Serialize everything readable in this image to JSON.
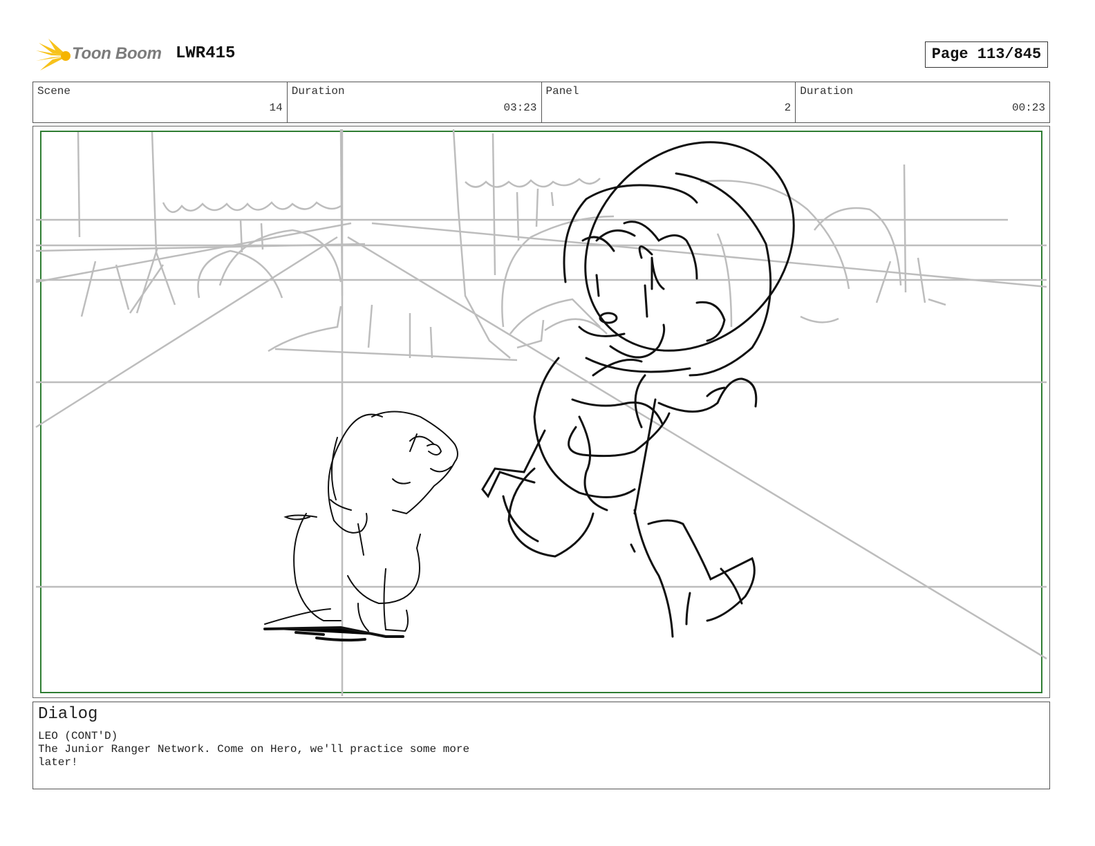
{
  "header": {
    "logo_text": "Toon Boom",
    "logo_color": "#f7c21b",
    "project_code": "LWR415",
    "page_label": "Page 113/845"
  },
  "info": {
    "scene_label": "Scene",
    "scene_value": "14",
    "scene_duration_label": "Duration",
    "scene_duration_value": "03:23",
    "panel_label": "Panel",
    "panel_value": "2",
    "panel_duration_label": "Duration",
    "panel_duration_value": "00:23"
  },
  "panel_frame": {
    "safe_area_color": "#2e7d32",
    "drawing_subject": "storyboard sketch",
    "line_color": "#000000",
    "background_line_color": "#bdbdbd"
  },
  "dialog": {
    "title": "Dialog",
    "speaker": "LEO (CONT'D)",
    "line1": "The Junior Ranger Network. Come on Hero, we'll practice some more",
    "line2": "later!"
  }
}
